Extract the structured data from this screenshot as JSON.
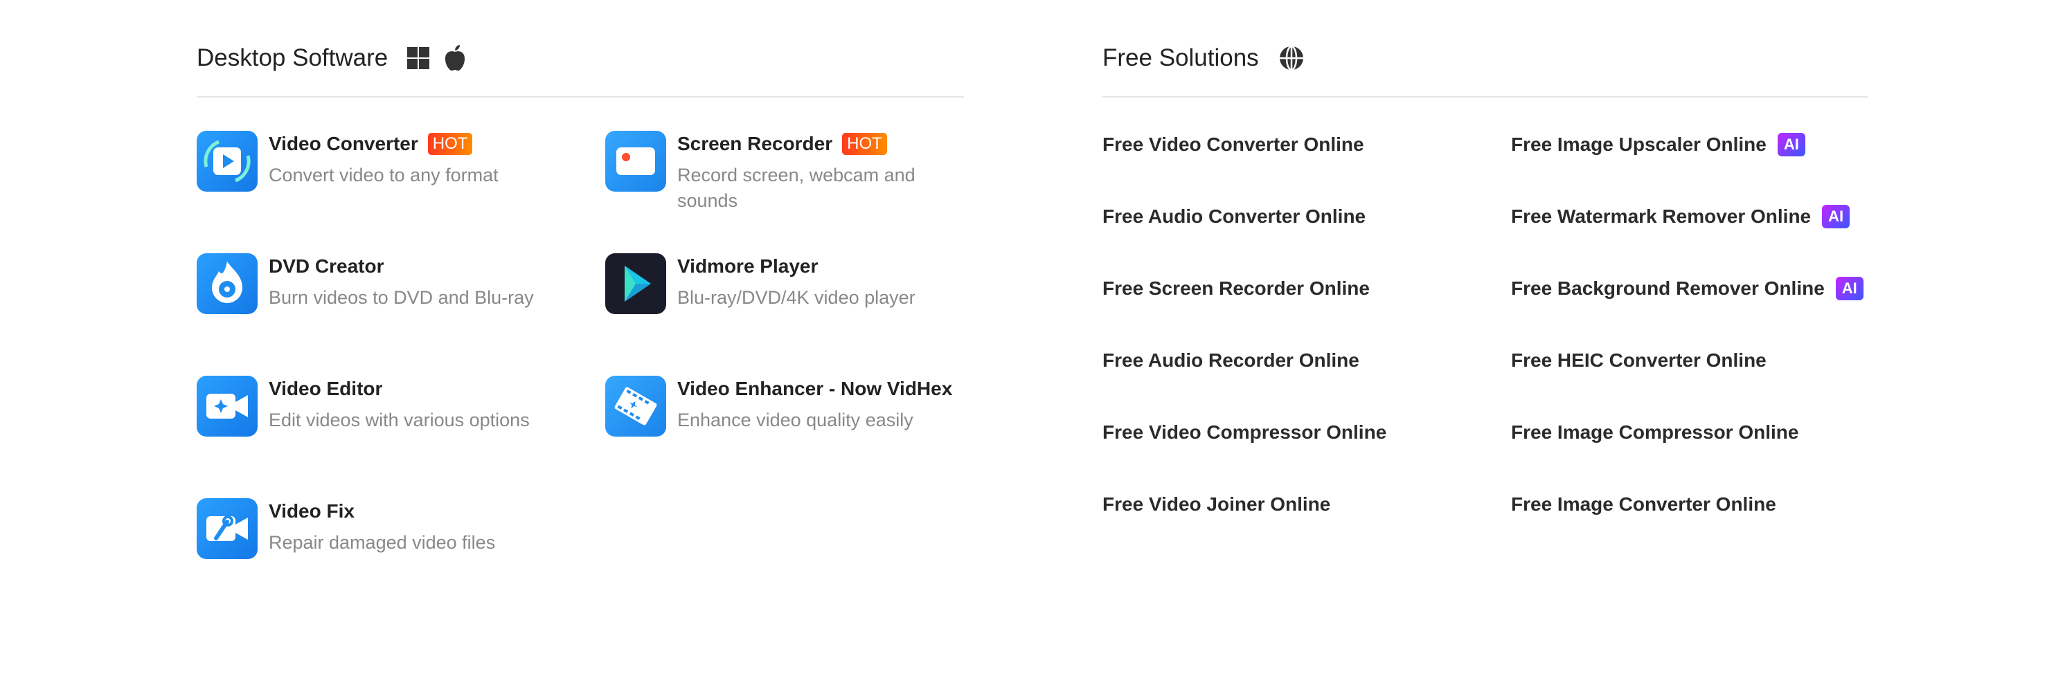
{
  "desktop": {
    "title": "Desktop Software",
    "platform_icons": [
      "windows-icon",
      "apple-icon"
    ],
    "products": [
      {
        "name": "Video Converter",
        "badge": "HOT",
        "desc": "Convert video to any format",
        "icon": "video-converter-icon"
      },
      {
        "name": "Screen Recorder",
        "badge": "HOT",
        "desc": "Record screen, webcam and sounds",
        "icon": "screen-recorder-icon"
      },
      {
        "name": "DVD Creator",
        "badge": "",
        "desc": "Burn videos to DVD and Blu-ray",
        "icon": "dvd-creator-icon"
      },
      {
        "name": "Vidmore Player",
        "badge": "",
        "desc": "Blu-ray/DVD/4K video player",
        "icon": "vidmore-player-icon"
      },
      {
        "name": "Video Editor",
        "badge": "",
        "desc": "Edit videos with various options",
        "icon": "video-editor-icon"
      },
      {
        "name": "Video Enhancer - Now VidHex",
        "badge": "",
        "desc": "Enhance video quality easily",
        "icon": "video-enhancer-icon"
      },
      {
        "name": "Video Fix",
        "badge": "",
        "desc": "Repair damaged video files",
        "icon": "video-fix-icon"
      }
    ]
  },
  "free": {
    "title": "Free Solutions",
    "globe_icon": "globe-icon",
    "left": [
      "Free Video Converter Online",
      "Free Audio Converter Online",
      "Free Screen Recorder Online",
      "Free Audio Recorder Online",
      "Free Video Compressor Online",
      "Free Video Joiner Online"
    ],
    "right": [
      {
        "label": "Free Image Upscaler Online",
        "badge": "AI"
      },
      {
        "label": "Free Watermark Remover Online",
        "badge": "AI"
      },
      {
        "label": "Free Background Remover Online",
        "badge": "AI"
      },
      {
        "label": "Free HEIC Converter Online",
        "badge": ""
      },
      {
        "label": "Free Image Compressor Online",
        "badge": ""
      },
      {
        "label": "Free Image Converter Online",
        "badge": ""
      }
    ]
  },
  "colors": {
    "app_blue": "#1e8df0",
    "hot_badge": "#ff5a1f",
    "ai_badge": "#7a3cff",
    "player_dark": "#1a1d29"
  }
}
